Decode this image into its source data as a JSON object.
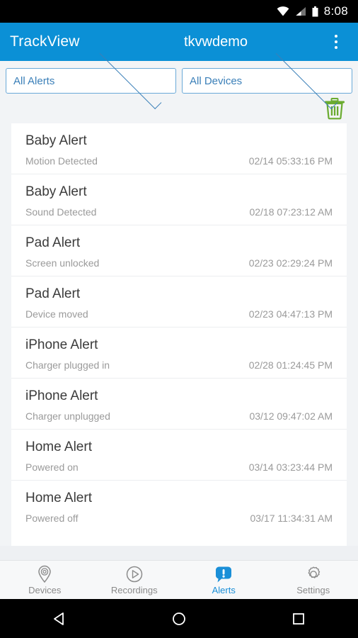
{
  "status_bar": {
    "time": "8:08",
    "icons": [
      "wifi-icon",
      "signal-icon",
      "battery-icon"
    ]
  },
  "app_bar": {
    "app_title": "TrackView",
    "account_name": "tkvwdemo",
    "overflow_label": "overflow-menu"
  },
  "filters": {
    "alert_filter": {
      "value": "All Alerts",
      "icon": "chevron-down-icon"
    },
    "device_filter": {
      "value": "All Devices",
      "icon": "chevron-down-icon"
    },
    "delete_all": {
      "icon": "trash-icon",
      "color": "#6aab2f"
    }
  },
  "alerts": [
    {
      "title": "Baby Alert",
      "description": "Motion Detected",
      "timestamp": "02/14 05:33:16 PM"
    },
    {
      "title": "Baby Alert",
      "description": "Sound Detected",
      "timestamp": "02/18 07:23:12 AM"
    },
    {
      "title": "Pad Alert",
      "description": "Screen unlocked",
      "timestamp": "02/23 02:29:24 PM"
    },
    {
      "title": "Pad Alert",
      "description": "Device moved",
      "timestamp": "02/23 04:47:13 PM"
    },
    {
      "title": "iPhone Alert",
      "description": "Charger plugged in",
      "timestamp": "02/28 01:24:45 PM"
    },
    {
      "title": "iPhone Alert",
      "description": "Charger unplugged",
      "timestamp": "03/12 09:47:02 AM"
    },
    {
      "title": "Home Alert",
      "description": "Powered on",
      "timestamp": "03/14 03:23:44 PM"
    },
    {
      "title": "Home Alert",
      "description": "Powered off",
      "timestamp": "03/17 11:34:31 AM"
    }
  ],
  "bottom_tabs": [
    {
      "label": "Devices",
      "icon": "map-pin-icon",
      "active": false
    },
    {
      "label": "Recordings",
      "icon": "play-circle-icon",
      "active": false
    },
    {
      "label": "Alerts",
      "icon": "alert-bubble-icon",
      "active": true
    },
    {
      "label": "Settings",
      "icon": "gear-icon",
      "active": false
    }
  ],
  "android_nav": [
    {
      "label": "back",
      "icon": "back-triangle-icon"
    },
    {
      "label": "home",
      "icon": "home-circle-icon"
    },
    {
      "label": "recents",
      "icon": "recents-square-icon"
    }
  ],
  "colors": {
    "accent": "#0b90d6",
    "link": "#3a7fb8",
    "trash": "#6aab2f",
    "page_bg": "#f2f4f6"
  }
}
